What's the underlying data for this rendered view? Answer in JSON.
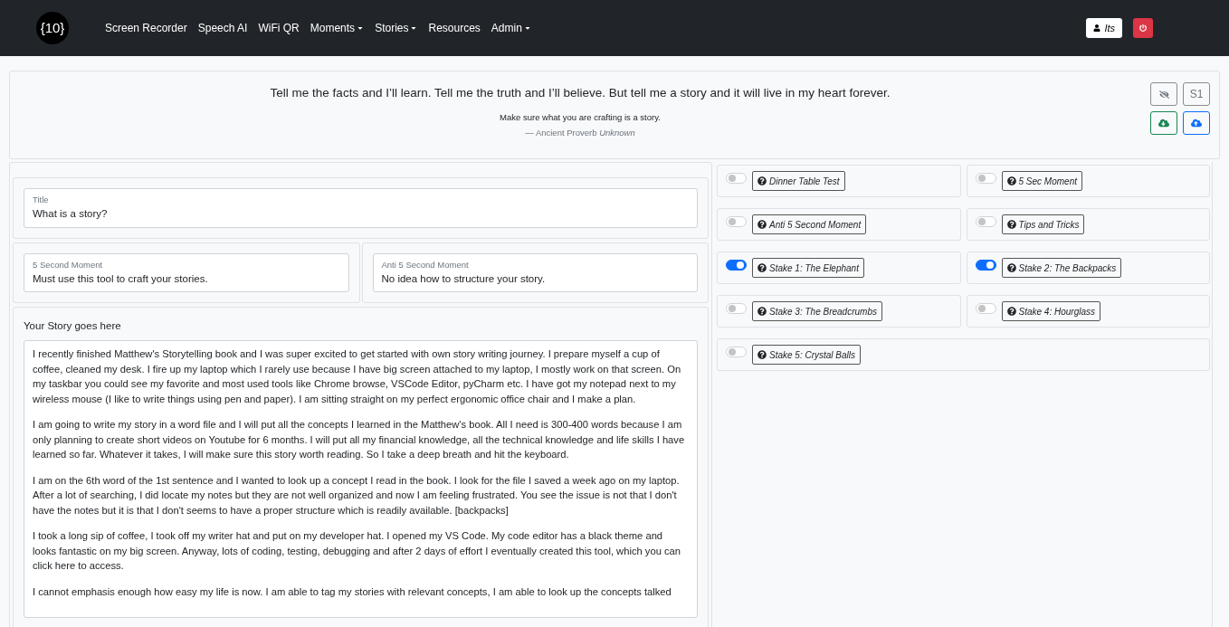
{
  "navbar": {
    "logo": "{10}",
    "links": [
      {
        "label": "Screen Recorder",
        "dropdown": false
      },
      {
        "label": "Speech AI",
        "dropdown": false
      },
      {
        "label": "WiFi QR",
        "dropdown": false
      },
      {
        "label": "Moments",
        "dropdown": true
      },
      {
        "label": "Stories",
        "dropdown": true
      },
      {
        "label": "Resources",
        "dropdown": false
      },
      {
        "label": "Admin",
        "dropdown": true
      }
    ],
    "user": "Its"
  },
  "quote": {
    "text": "Tell me the facts and I’ll learn. Tell me the truth and I’ll believe. But tell me a story and it will live in my heart forever.",
    "note": "Make sure what you are crafting is a story.",
    "source": "— Ancient Proverb",
    "author": "Unknown",
    "stage_button": "S1"
  },
  "title_field": {
    "label": "Title",
    "value": "What is a story?"
  },
  "moment_fields": [
    {
      "label": "5 Second Moment",
      "value": "Must use this tool to craft your stories."
    },
    {
      "label": "Anti 5 Second Moment",
      "value": "No idea how to structure your story."
    }
  ],
  "story": {
    "label": "Your Story goes here",
    "paragraphs": [
      "I recently finished Matthew's Storytelling book and I was super excited to get started with own story writing journey. I prepare myself a cup of coffee, cleaned my desk. I fire up my laptop which I rarely use because I have big screen attached to my laptop, I mostly work on that screen. On my taskbar you could see my favorite and most used tools like Chrome browse, VSCode Editor, pyCharm etc. I have got my notepad next to my wireless mouse (I like to write things using pen and paper). I am sitting straight on my perfect ergonomic office chair and I make a plan.",
      "I am going to write my story in a word file and I will put all the concepts I learned in the Matthew's book. All I need is 300-400 words because I am only planning to create short videos on Youtube for 6 months. I will put all my financial knowledge, all the technical knowledge and life skills I have learned so far. Whatever it takes, I will make sure this story worth reading. So I take a deep breath and hit the keyboard.",
      "I am on the 6th word of the 1st sentence and I wanted to look up a concept I read in the book. I look for the file I saved a week ago on my laptop. After a lot of searching, I did locate my notes but they are not well organized and now I am feeling frustrated. You see the issue is not that I don't have the notes but it is that I don't seems to have a proper structure which is readily available. [backpacks]",
      "I took a long sip of coffee, I took off my writer hat and put on my developer hat. I opened my VS Code. My code editor has a black theme and looks fantastic on my big screen. Anyway, lots of coding, testing, debugging and after 2 days of effort I eventually created this tool, which you can click here to access.",
      "I cannot emphasis enough how easy my life is now. I am able to tag my stories with relevant concepts, I am able to look up the concepts talked"
    ]
  },
  "toggles": [
    {
      "label": "Dinner Table Test",
      "on": false
    },
    {
      "label": "5 Sec Moment",
      "on": false
    },
    {
      "label": "Anti 5 Second Moment",
      "on": false
    },
    {
      "label": "Tips and Tricks",
      "on": false
    },
    {
      "label": "Stake 1: The Elephant",
      "on": true
    },
    {
      "label": "Stake 2: The Backpacks",
      "on": true
    },
    {
      "label": "Stake 3: The Breadcrumbs",
      "on": false
    },
    {
      "label": "Stake 4: Hourglass",
      "on": false
    },
    {
      "label": "Stake 5: Crystal Balls",
      "on": false
    }
  ]
}
